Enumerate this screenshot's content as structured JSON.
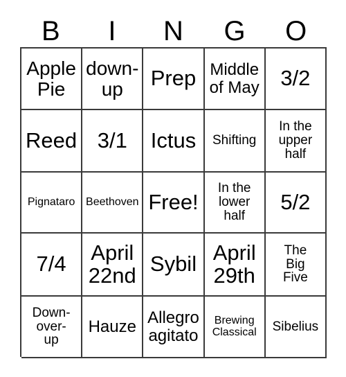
{
  "card": {
    "title": "BINGO",
    "headers": [
      "B",
      "I",
      "N",
      "G",
      "O"
    ],
    "free_space_label": "Free!",
    "columns": {
      "B": [
        "Apple\nPie",
        "Reed",
        "Pignataro",
        "7/4",
        "Down-\nover-\nup"
      ],
      "I": [
        "down-\nup",
        "3/1",
        "Beethoven",
        "April\n22nd",
        "Hauze"
      ],
      "N": [
        "Prep",
        "Ictus",
        "Free!",
        "Sybil",
        "Allegro\nagitato"
      ],
      "G": [
        "Middle\nof May",
        "Shifting",
        "In the\nlower\nhalf",
        "April\n29th",
        "Brewing\nClassical"
      ],
      "O": [
        "3/2",
        "In the\nupper\nhalf",
        "5/2",
        "The\nBig\nFive",
        "Sibelius"
      ]
    },
    "rows": [
      [
        {
          "text": "Apple\nPie",
          "size": "s-lg"
        },
        {
          "text": "down-\nup",
          "size": "s-lg"
        },
        {
          "text": "Prep",
          "size": "s-xl"
        },
        {
          "text": "Middle\nof May",
          "size": "s-md"
        },
        {
          "text": "3/2",
          "size": "s-xl"
        }
      ],
      [
        {
          "text": "Reed",
          "size": "s-xl"
        },
        {
          "text": "3/1",
          "size": "s-xl"
        },
        {
          "text": "Ictus",
          "size": "s-xl"
        },
        {
          "text": "Shifting",
          "size": "s-sm"
        },
        {
          "text": "In the\nupper\nhalf",
          "size": "s-sm"
        }
      ],
      [
        {
          "text": "Pignataro",
          "size": "s-xs"
        },
        {
          "text": "Beethoven",
          "size": "s-xs"
        },
        {
          "text": "Free!",
          "size": "s-xl"
        },
        {
          "text": "In the\nlower\nhalf",
          "size": "s-sm"
        },
        {
          "text": "5/2",
          "size": "s-xl"
        }
      ],
      [
        {
          "text": "7/4",
          "size": "s-xl"
        },
        {
          "text": "April\n22nd",
          "size": "s-xl"
        },
        {
          "text": "Sybil",
          "size": "s-xl"
        },
        {
          "text": "April\n29th",
          "size": "s-xl"
        },
        {
          "text": "The\nBig\nFive",
          "size": "s-sm"
        }
      ],
      [
        {
          "text": "Down-\nover-\nup",
          "size": "s-sm"
        },
        {
          "text": "Hauze",
          "size": "s-md"
        },
        {
          "text": "Allegro\nagitato",
          "size": "s-md"
        },
        {
          "text": "Brewing\nClassical",
          "size": "s-xs"
        },
        {
          "text": "Sibelius",
          "size": "s-sm"
        }
      ]
    ]
  },
  "colors": {
    "background": "#ffffff",
    "text": "#000000",
    "grid_line": "#3a3a3a"
  }
}
